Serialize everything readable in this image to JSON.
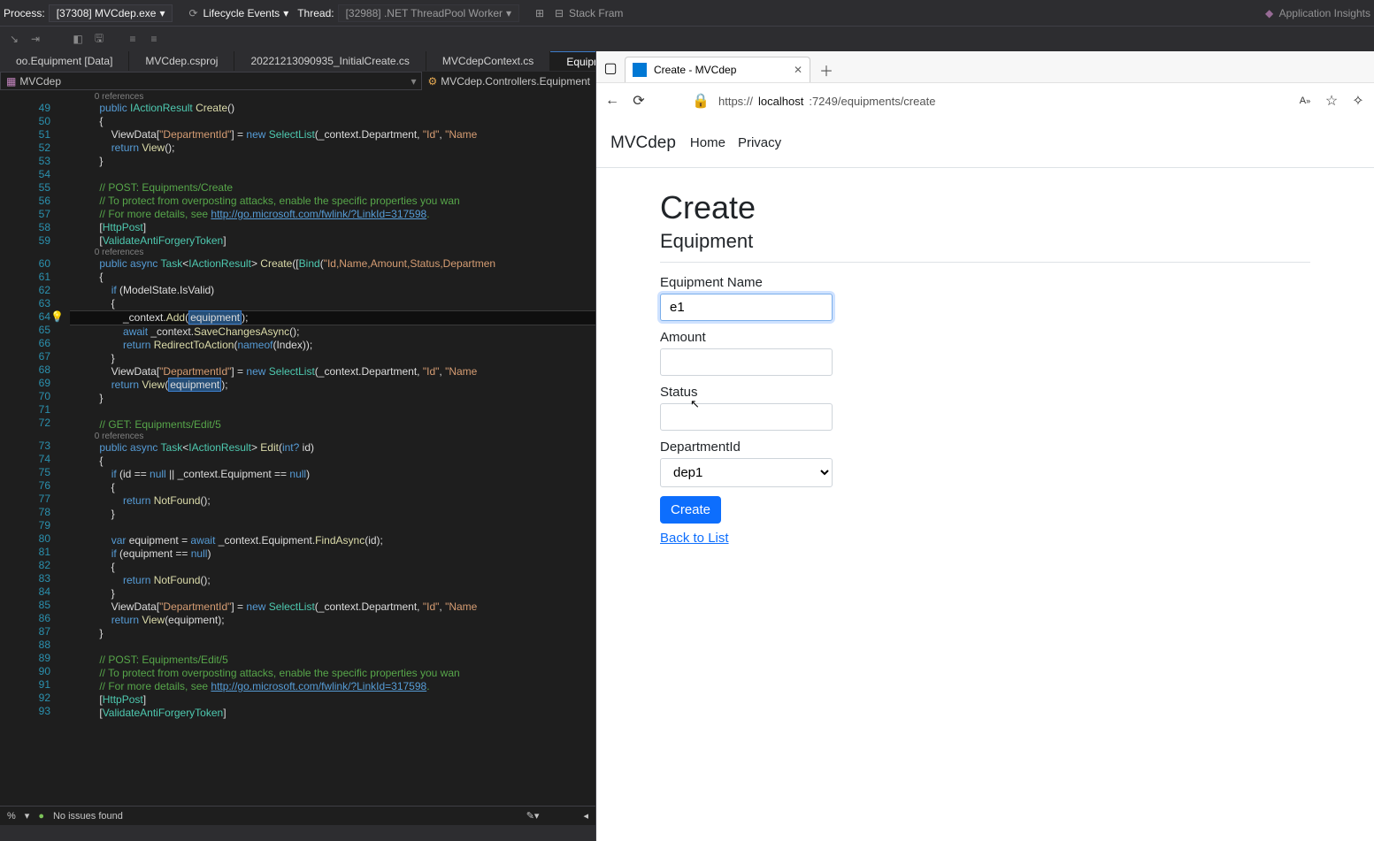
{
  "vs": {
    "process_label": "Process:",
    "process_value": "[37308] MVCdep.exe",
    "lifecycle": "Lifecycle Events",
    "thread_label": "Thread:",
    "thread_value": "[32988] .NET ThreadPool Worker",
    "stack": "Stack Fram",
    "app_insights": "Application Insights",
    "tabs": [
      "oo.Equipment [Data]",
      "MVCdep.csproj",
      "20221213090935_InitialCreate.cs",
      "MVCdepContext.cs",
      "EquipmentsCont…"
    ],
    "crumb_left": "MVCdep",
    "crumb_right": "MVCdep.Controllers.Equipment",
    "refs": "0 references",
    "no_issues": "No issues found",
    "ln_start": 49
  },
  "browser": {
    "tab_title": "Create - MVCdep",
    "url_prefix": "https://",
    "url_domain": "localhost",
    "url_rest": ":7249/equipments/create",
    "brand": "MVCdep",
    "nav_home": "Home",
    "nav_privacy": "Privacy",
    "heading": "Create",
    "subhead": "Equipment",
    "label_name": "Equipment Name",
    "val_name": "e1",
    "label_amount": "Amount",
    "val_amount": "",
    "label_status": "Status",
    "val_status": "",
    "label_dep": "DepartmentId",
    "val_dep": "dep1",
    "btn_create": "Create",
    "back": "Back to List"
  },
  "code": [
    {
      "t": "ref",
      "txt": "0 references",
      "indent": 10
    },
    {
      "n": 49,
      "html": "          <span class='kw'>public</span> <span class='type'>IActionResult</span> <span class='mth'>Create</span>()"
    },
    {
      "n": 50,
      "html": "          {"
    },
    {
      "n": 51,
      "html": "              ViewData[<span class='str'>\"DepartmentId\"</span>] = <span class='kw'>new</span> <span class='type'>SelectList</span>(_context.Department, <span class='str'>\"Id\"</span>, <span class='str'>\"Name</span>"
    },
    {
      "n": 52,
      "html": "              <span class='kw'>return</span> <span class='mth'>View</span>();"
    },
    {
      "n": 53,
      "html": "          }"
    },
    {
      "n": 54,
      "html": ""
    },
    {
      "n": 55,
      "html": "          <span class='cm'>// POST: Equipments/Create</span>"
    },
    {
      "n": 56,
      "html": "          <span class='cm'>// To protect from overposting attacks, enable the specific properties you wan</span>"
    },
    {
      "n": 57,
      "html": "          <span class='cm'>// For more details, see </span><span class='cm link'>http://go.microsoft.com/fwlink/?LinkId=317598</span><span class='cm'>.</span>"
    },
    {
      "n": 58,
      "html": "          [<span class='type'>HttpPost</span>]"
    },
    {
      "n": 59,
      "html": "          [<span class='type'>ValidateAntiForgeryToken</span>]"
    },
    {
      "t": "ref",
      "txt": "0 references",
      "indent": 10
    },
    {
      "n": 60,
      "html": "          <span class='kw'>public</span> <span class='kw'>async</span> <span class='type'>Task</span>&lt;<span class='type'>IActionResult</span>&gt; <span class='mth'>Create</span>([<span class='type'>Bind</span>(<span class='str'>\"Id,Name,Amount,Status,Departmen</span>"
    },
    {
      "n": 61,
      "html": "          {"
    },
    {
      "n": 62,
      "html": "              <span class='kw'>if</span> (ModelState.IsValid)"
    },
    {
      "n": 63,
      "html": "              {"
    },
    {
      "n": 64,
      "html": "                  _context.<span class='mth'>Add</span>(<span class='sel'>equipment</span>);",
      "bulb": true,
      "hl": true
    },
    {
      "n": 65,
      "html": "                  <span class='kw'>await</span> _context.<span class='mth'>SaveChangesAsync</span>();"
    },
    {
      "n": 66,
      "html": "                  <span class='kw'>return</span> <span class='mth'>RedirectToAction</span>(<span class='kw'>nameof</span>(Index));"
    },
    {
      "n": 67,
      "html": "              }"
    },
    {
      "n": 68,
      "html": "              ViewData[<span class='str'>\"DepartmentId\"</span>] = <span class='kw'>new</span> <span class='type'>SelectList</span>(_context.Department, <span class='str'>\"Id\"</span>, <span class='str'>\"Name</span>"
    },
    {
      "n": 69,
      "html": "              <span class='kw'>return</span> <span class='mth'>View</span>(<span class='sel'>equipment</span>);"
    },
    {
      "n": 70,
      "html": "          }"
    },
    {
      "n": 71,
      "html": ""
    },
    {
      "n": 72,
      "html": "          <span class='cm'>// GET: Equipments/Edit/5</span>"
    },
    {
      "t": "ref",
      "txt": "0 references",
      "indent": 10
    },
    {
      "n": 73,
      "html": "          <span class='kw'>public</span> <span class='kw'>async</span> <span class='type'>Task</span>&lt;<span class='type'>IActionResult</span>&gt; <span class='mth'>Edit</span>(<span class='kw'>int?</span> id)"
    },
    {
      "n": 74,
      "html": "          {"
    },
    {
      "n": 75,
      "html": "              <span class='kw'>if</span> (id == <span class='kw'>null</span> || _context.Equipment == <span class='kw'>null</span>)"
    },
    {
      "n": 76,
      "html": "              {"
    },
    {
      "n": 77,
      "html": "                  <span class='kw'>return</span> <span class='mth'>NotFound</span>();"
    },
    {
      "n": 78,
      "html": "              }"
    },
    {
      "n": 79,
      "html": ""
    },
    {
      "n": 80,
      "html": "              <span class='kw'>var</span> equipment = <span class='kw'>await</span> _context.Equipment.<span class='mth'>FindAsync</span>(id);"
    },
    {
      "n": 81,
      "html": "              <span class='kw'>if</span> (equipment == <span class='kw'>null</span>)"
    },
    {
      "n": 82,
      "html": "              {"
    },
    {
      "n": 83,
      "html": "                  <span class='kw'>return</span> <span class='mth'>NotFound</span>();"
    },
    {
      "n": 84,
      "html": "              }"
    },
    {
      "n": 85,
      "html": "              ViewData[<span class='str'>\"DepartmentId\"</span>] = <span class='kw'>new</span> <span class='type'>SelectList</span>(_context.Department, <span class='str'>\"Id\"</span>, <span class='str'>\"Name</span>"
    },
    {
      "n": 86,
      "html": "              <span class='kw'>return</span> <span class='mth'>View</span>(equipment);"
    },
    {
      "n": 87,
      "html": "          }"
    },
    {
      "n": 88,
      "html": ""
    },
    {
      "n": 89,
      "html": "          <span class='cm'>// POST: Equipments/Edit/5</span>"
    },
    {
      "n": 90,
      "html": "          <span class='cm'>// To protect from overposting attacks, enable the specific properties you wan</span>"
    },
    {
      "n": 91,
      "html": "          <span class='cm'>// For more details, see </span><span class='cm link'>http://go.microsoft.com/fwlink/?LinkId=317598</span><span class='cm'>.</span>"
    },
    {
      "n": 92,
      "html": "          [<span class='type'>HttpPost</span>]"
    },
    {
      "n": 93,
      "html": "          [<span class='type'>ValidateAntiForgeryToken</span>]"
    }
  ]
}
